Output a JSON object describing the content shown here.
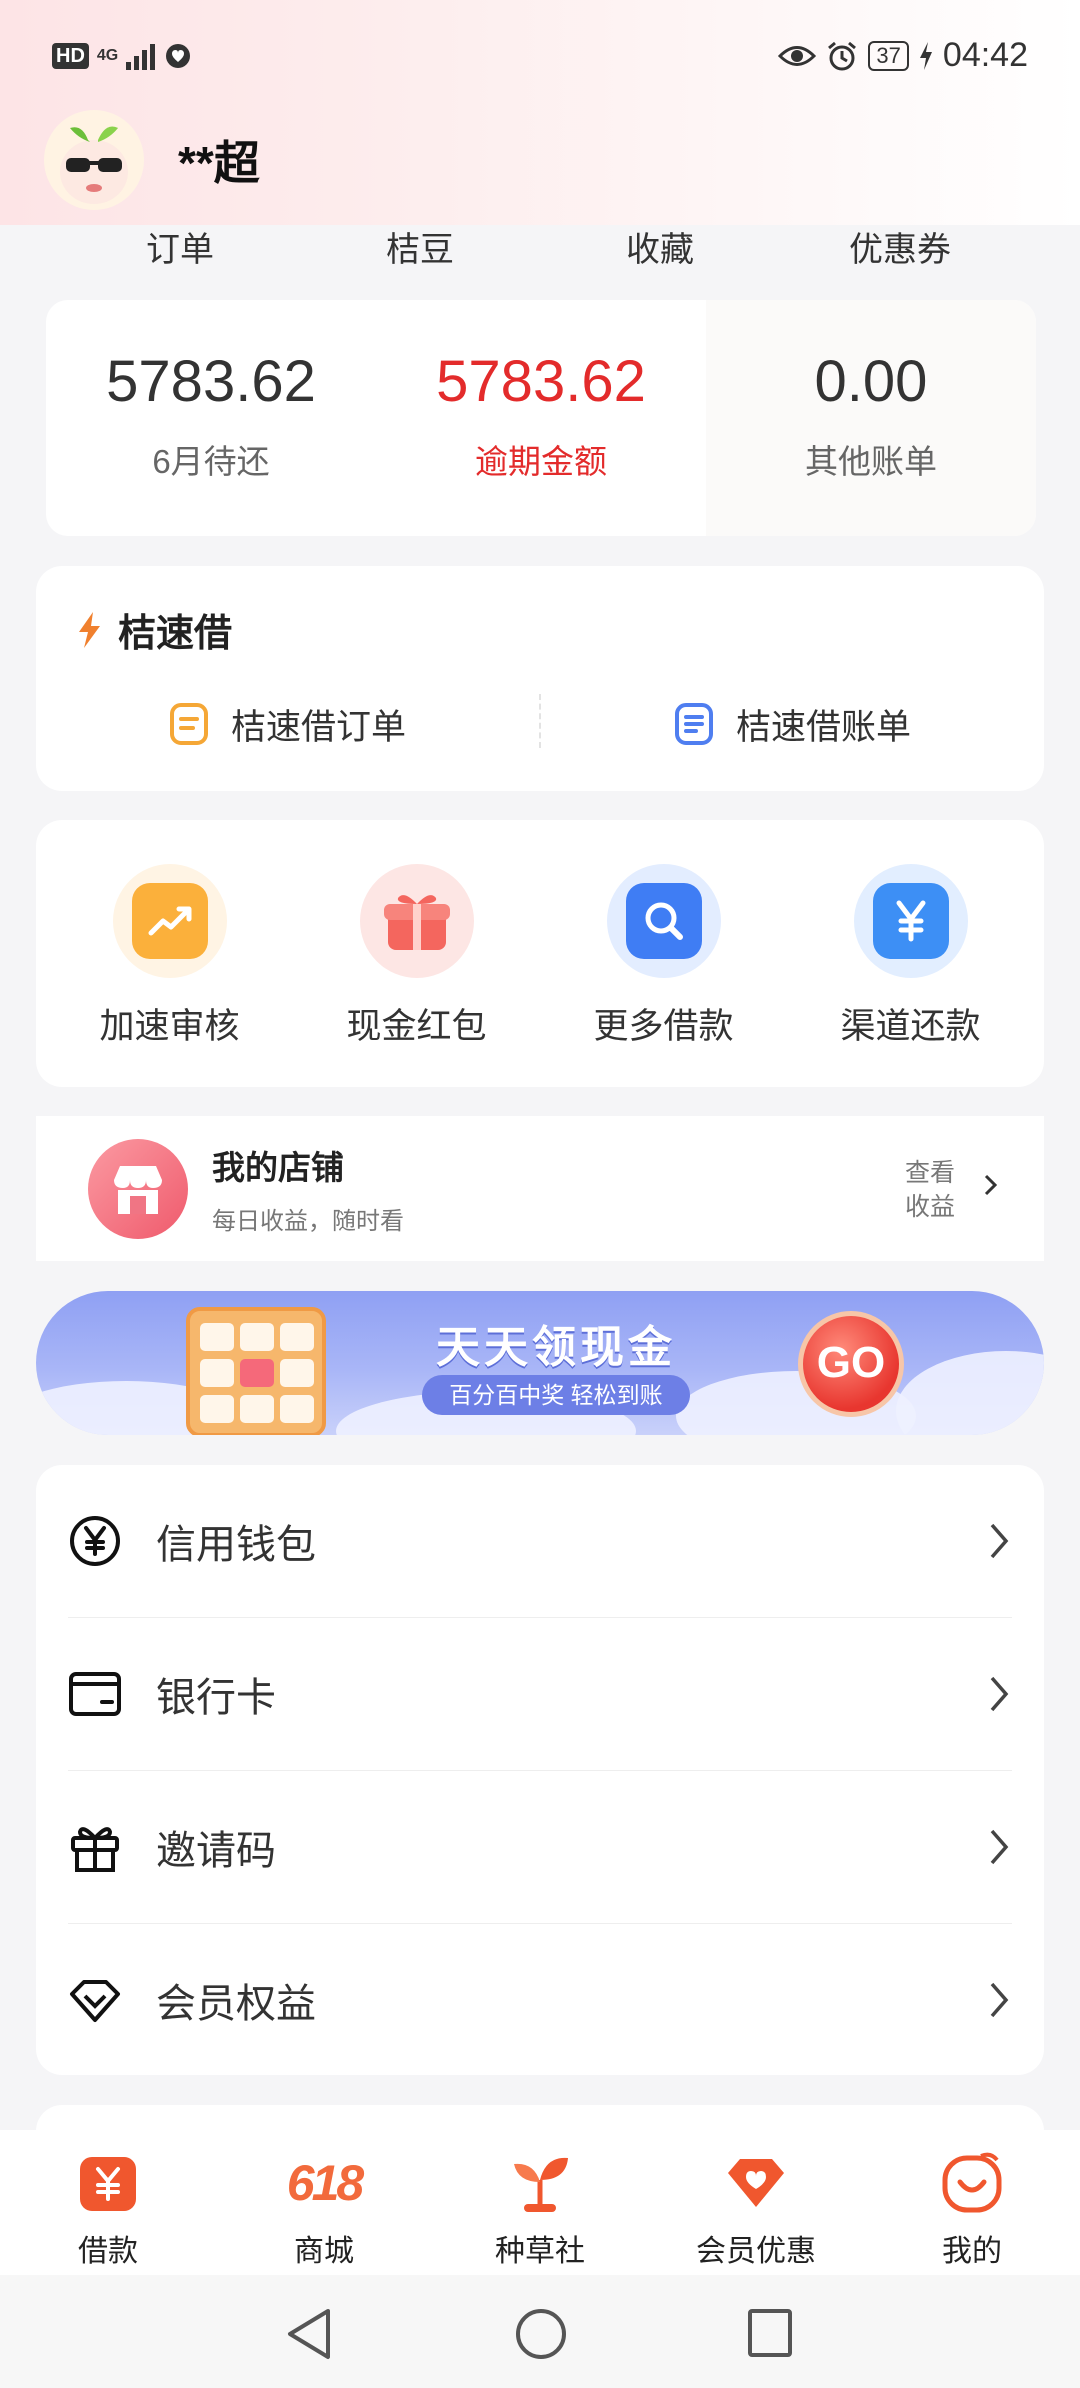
{
  "status_bar": {
    "hd": "HD",
    "network": "4G",
    "battery": "37",
    "time": "04:42"
  },
  "profile": {
    "username": "**超"
  },
  "quick_tabs": [
    "订单",
    "桔豆",
    "收藏",
    "优惠券"
  ],
  "bills": [
    {
      "value": "5783.62",
      "label": "6月待还"
    },
    {
      "value": "5783.62",
      "label": "逾期金额"
    },
    {
      "value": "0.00",
      "label": "其他账单"
    }
  ],
  "jsj": {
    "title": "桔速借",
    "order_label": "桔速借订单",
    "bill_label": "桔速借账单"
  },
  "services": [
    {
      "label": "加速审核",
      "icon": "trend-up-icon",
      "color": "#fbb03b"
    },
    {
      "label": "现金红包",
      "icon": "gift-icon",
      "color": "#f4665e"
    },
    {
      "label": "更多借款",
      "icon": "search-icon",
      "color": "#3f7df4"
    },
    {
      "label": "渠道还款",
      "icon": "yuan-icon",
      "color": "#3d8ff5"
    }
  ],
  "shop": {
    "title": "我的店铺",
    "subtitle": "每日收益，随时看",
    "more_line1": "查看",
    "more_line2": "收益"
  },
  "banner": {
    "title": "天天领现金",
    "subtitle": "百分百中奖 轻松到账",
    "go": "GO"
  },
  "menu": [
    {
      "label": "信用钱包",
      "icon": "yuan-circle-icon"
    },
    {
      "label": "银行卡",
      "icon": "wallet-icon"
    },
    {
      "label": "邀请码",
      "icon": "gift-icon"
    },
    {
      "label": "会员权益",
      "icon": "diamond-icon"
    }
  ],
  "tabbar": [
    {
      "label": "借款",
      "icon": "loan-icon"
    },
    {
      "label": "商城",
      "icon": "mall-618-icon",
      "badge": "618"
    },
    {
      "label": "种草社",
      "icon": "sprout-icon"
    },
    {
      "label": "会员优惠",
      "icon": "member-heart-icon"
    },
    {
      "label": "我的",
      "icon": "smile-icon"
    }
  ],
  "colors": {
    "accent_orange": "#f0572e",
    "overdue_red": "#e32b2b",
    "banner_blue": "#8fa0f3"
  }
}
